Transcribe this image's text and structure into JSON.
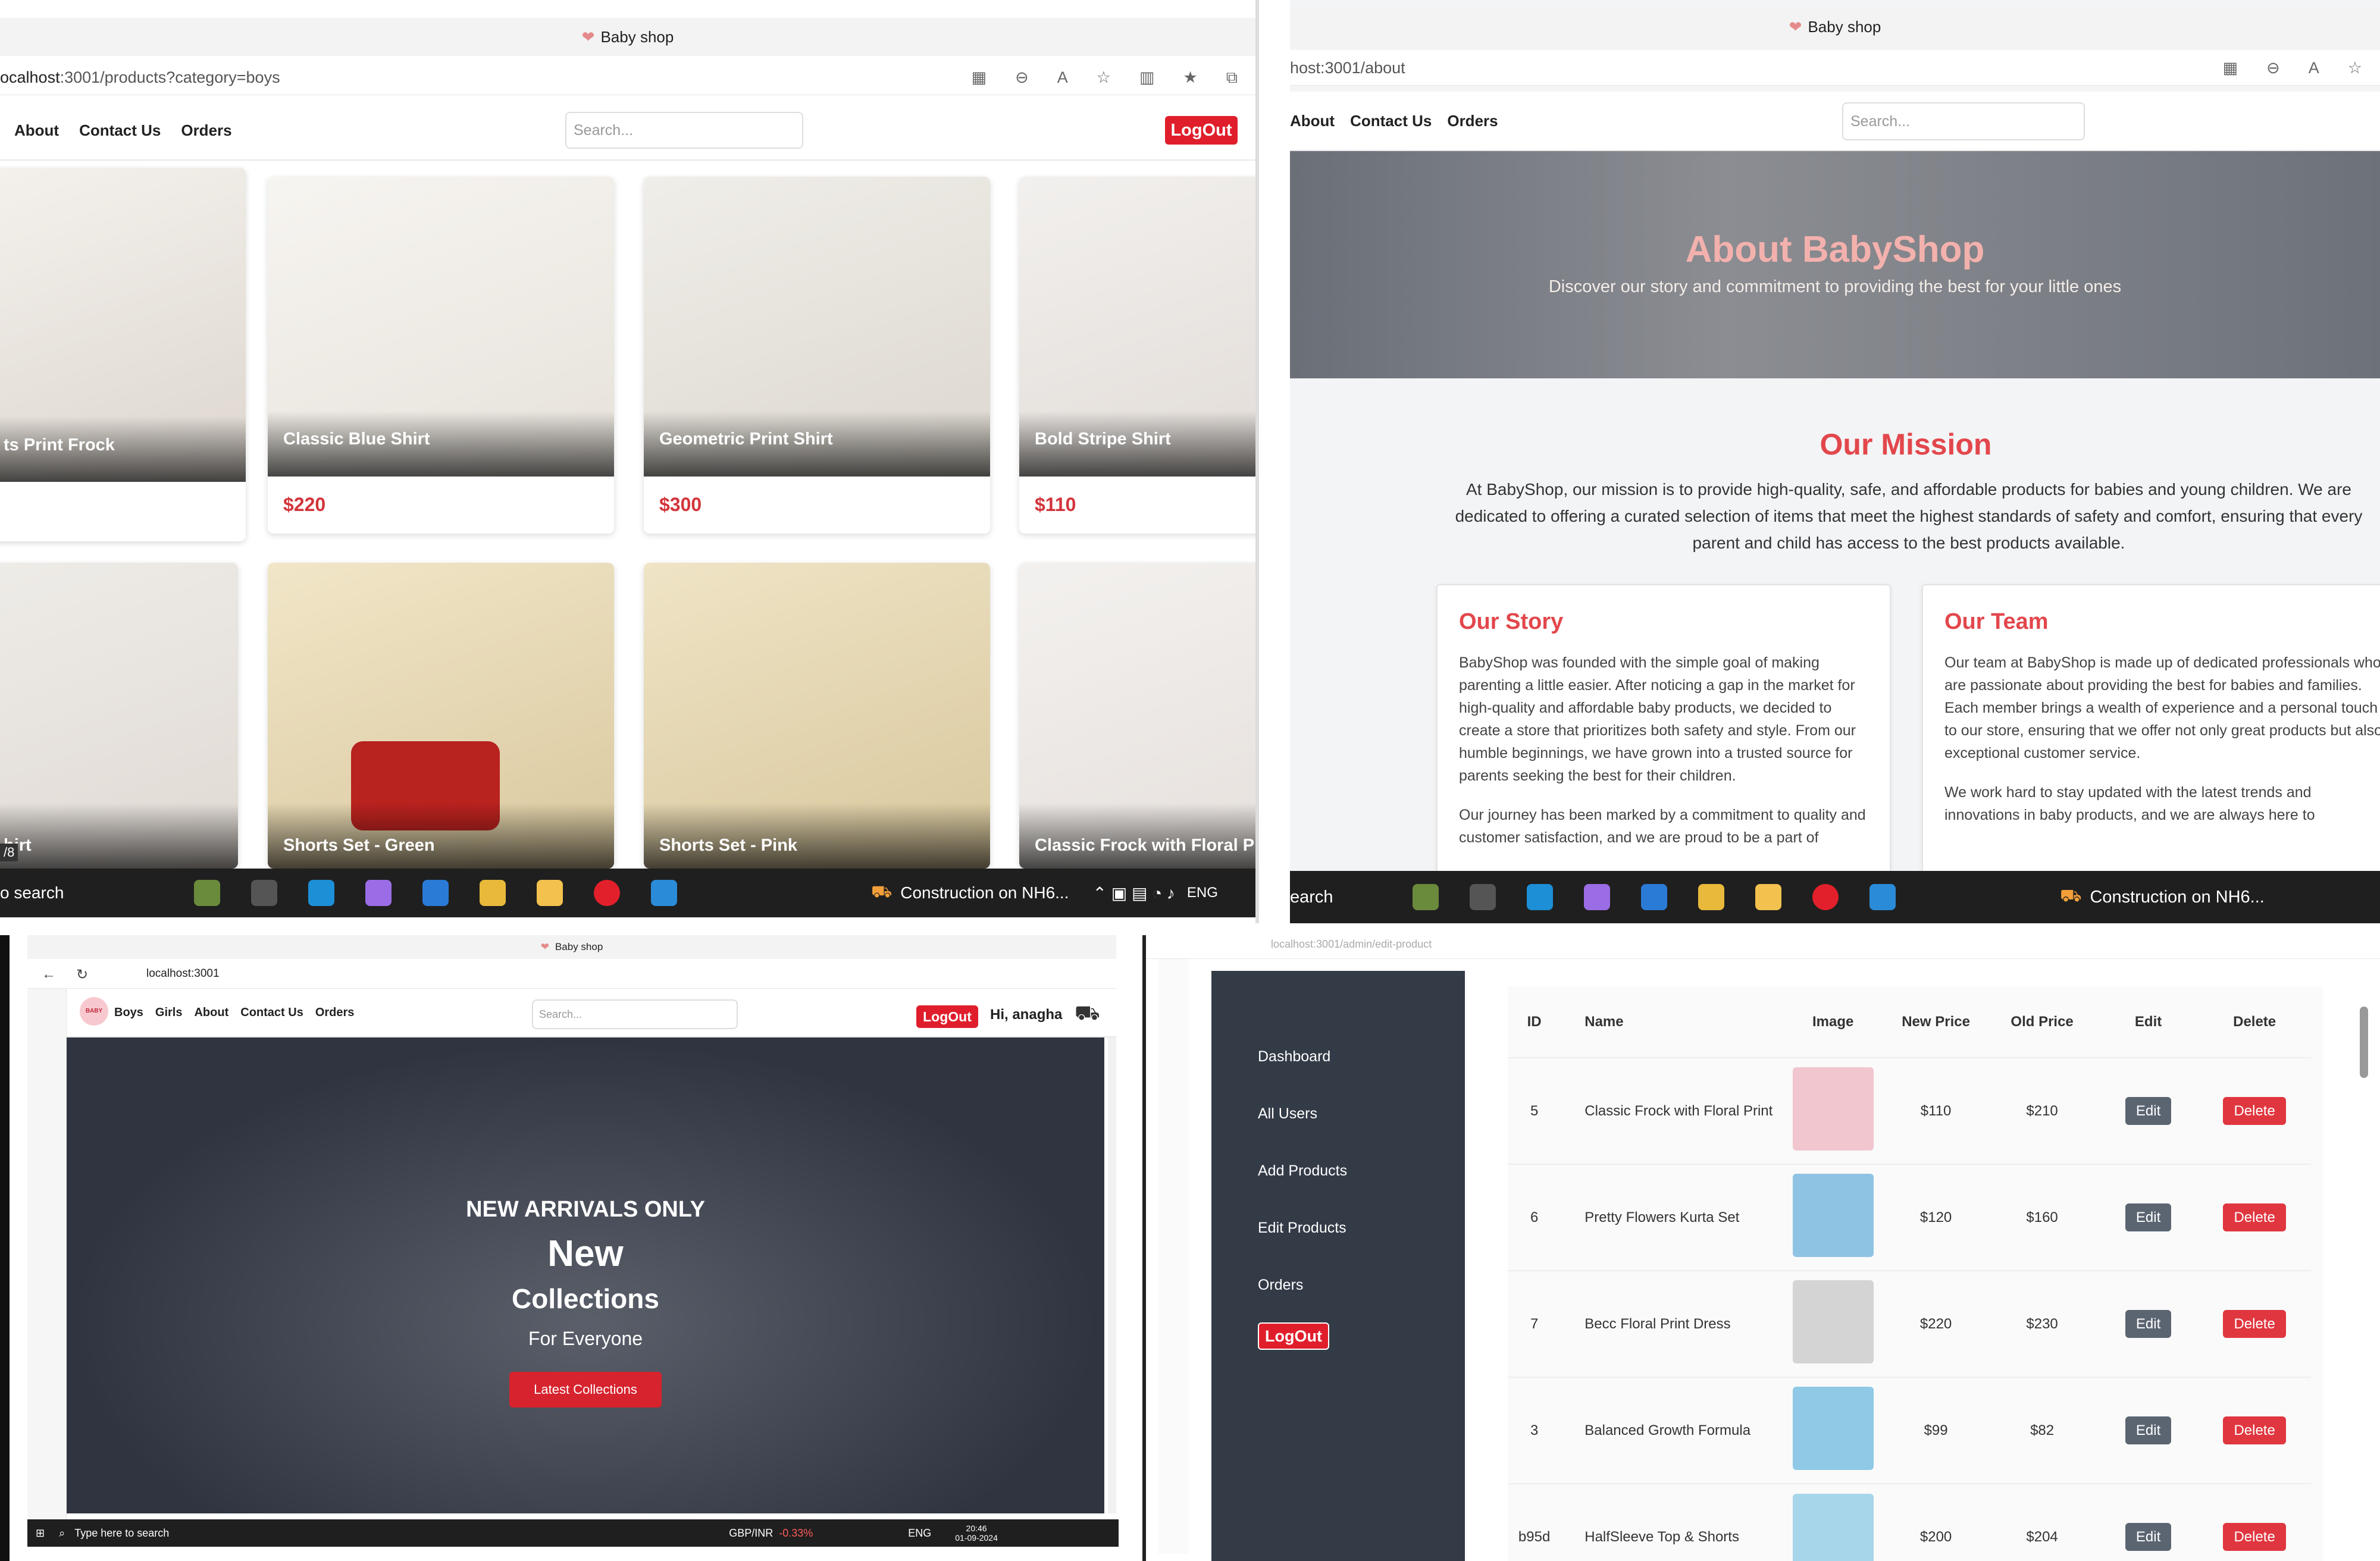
{
  "q1": {
    "tab_title": "Baby shop",
    "url_host": "ocalhost",
    "url_rest": ":3001/products?category=boys",
    "nav": [
      "About",
      "Contact Us",
      "Orders"
    ],
    "search_placeholder": "Search...",
    "logout": "LogOut",
    "products": [
      {
        "title": "ts Print Frock",
        "price": ""
      },
      {
        "title": "Classic Blue Shirt",
        "price": "$220"
      },
      {
        "title": "Geometric Print Shirt",
        "price": "$300"
      },
      {
        "title": "Bold Stripe Shirt",
        "price": "$110"
      },
      {
        "title": "hirt",
        "price": ""
      },
      {
        "title": "Shorts Set - Green",
        "price": ""
      },
      {
        "title": "Shorts Set - Pink",
        "price": ""
      },
      {
        "title": "Classic Frock with Floral Print",
        "price": ""
      }
    ],
    "page_counter": "/8",
    "taskbar_search": "o search",
    "news": "Construction on NH6...",
    "lang": "ENG"
  },
  "q2": {
    "tab_title": "Baby shop",
    "url": "host:3001/about",
    "nav": [
      "About",
      "Contact Us",
      "Orders"
    ],
    "search_placeholder": "Search...",
    "hero_title": "About BabyShop",
    "hero_sub": "Discover our story and commitment to providing the best for your little ones",
    "mission_title": "Our Mission",
    "mission_text": "At BabyShop, our mission is to provide high-quality, safe, and affordable products for babies and young children. We are dedicated to offering a curated selection of items that meet the highest standards of safety and comfort, ensuring that every parent and child has access to the best products available.",
    "story_title": "Our Story",
    "story_p1": "BabyShop was founded with the simple goal of making parenting a little easier. After noticing a gap in the market for high-quality and affordable baby products, we decided to create a store that prioritizes both safety and style. From our humble beginnings, we have grown into a trusted source for parents seeking the best for their children.",
    "story_p2": "Our journey has been marked by a commitment to quality and customer satisfaction, and we are proud to be a part of",
    "team_title": "Our Team",
    "team_p1": "Our team at BabyShop is made up of dedicated professionals who are passionate about providing the best for babies and families. Each member brings a wealth of experience and a personal touch to our store, ensuring that we offer not only great products but also exceptional customer service.",
    "team_p2": "We work hard to stay updated with the latest trends and innovations in baby products, and we are always here to",
    "taskbar_search": "earch",
    "news": "Construction on NH6..."
  },
  "q3": {
    "tab_title": "Baby shop",
    "url": "localhost:3001",
    "logo": "BABY",
    "nav": [
      "Boys",
      "Girls",
      "About",
      "Contact Us",
      "Orders"
    ],
    "search_placeholder": "Search...",
    "logout": "LogOut",
    "greeting": "Hi, anagha",
    "hero_kicker": "NEW ARRIVALS ONLY",
    "hero_line1": "New",
    "hero_line2": "Collections",
    "hero_line3": "For Everyone",
    "hero_button": "Latest Collections",
    "taskbar_search": "Type here to search",
    "currency": "GBP/INR",
    "currency_change": "-0.33%",
    "lang": "ENG",
    "time": "20:46",
    "date": "01-09-2024"
  },
  "q4": {
    "url": "localhost:3001/admin/edit-product",
    "sidebar": [
      "Dashboard",
      "All Users",
      "Add Products",
      "Edit Products",
      "Orders"
    ],
    "logout": "LogOut",
    "columns": [
      "ID",
      "Name",
      "Image",
      "New Price",
      "Old Price",
      "Edit",
      "Delete"
    ],
    "edit_label": "Edit",
    "delete_label": "Delete",
    "rows": [
      {
        "id": "5",
        "name": "Classic Frock with Floral Print",
        "new": "$110",
        "old": "$210"
      },
      {
        "id": "6",
        "name": "Pretty Flowers Kurta Set",
        "new": "$120",
        "old": "$160"
      },
      {
        "id": "7",
        "name": "Becc Floral Print Dress",
        "new": "$220",
        "old": "$230"
      },
      {
        "id": "3",
        "name": "Balanced Growth Formula",
        "new": "$99",
        "old": "$82"
      },
      {
        "id": "b95d",
        "name": "HalfSleeve Top & Shorts",
        "new": "$200",
        "old": "$204"
      }
    ]
  },
  "colors": {
    "accent": "#e01e2b",
    "mission": "#e2474c",
    "sidebar": "#333b47",
    "taskbar": "#1f1f1f"
  }
}
